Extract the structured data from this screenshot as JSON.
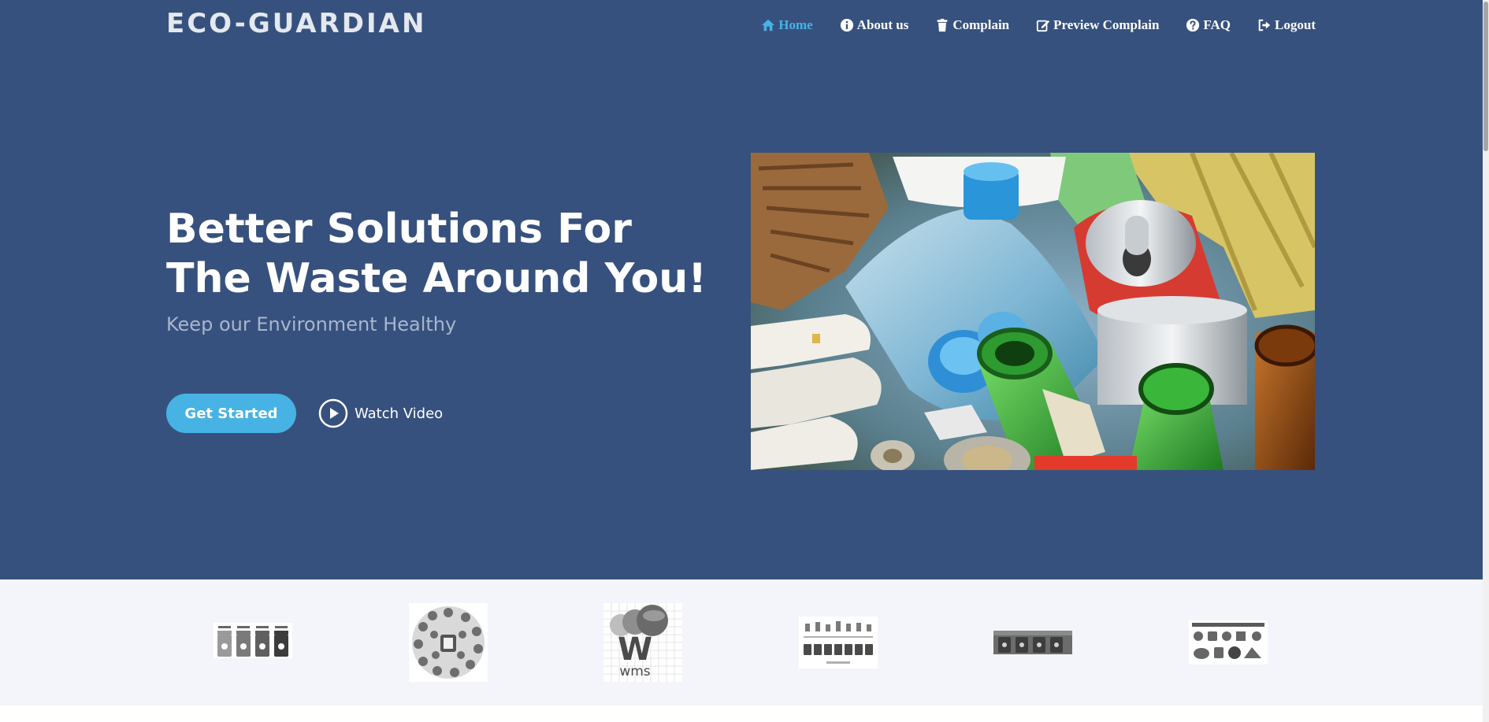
{
  "brand": {
    "logo": "ECO-GUARDIAN"
  },
  "nav": {
    "items": [
      {
        "label": "Home",
        "icon": "home-icon",
        "active": true
      },
      {
        "label": "About us",
        "icon": "info-circle-icon",
        "active": false
      },
      {
        "label": "Complain",
        "icon": "trash-icon",
        "active": false
      },
      {
        "label": "Preview Complain",
        "icon": "edit-icon",
        "active": false
      },
      {
        "label": "FAQ",
        "icon": "question-circle-icon",
        "active": false
      },
      {
        "label": "Logout",
        "icon": "logout-icon",
        "active": false
      }
    ]
  },
  "hero": {
    "title": "Better Solutions For The Waste Around You!",
    "subtitle": "Keep our Environment Healthy",
    "cta_label": "Get Started",
    "video_label": "Watch Video",
    "image_icon": "recyclable-waste-photo"
  },
  "clients": {
    "logos": [
      {
        "icon": "recycling-bins-logo"
      },
      {
        "icon": "eco-circle-icons-logo"
      },
      {
        "icon": "wms-logo",
        "text": "wms",
        "letter": "W"
      },
      {
        "icon": "waste-sorting-chart-logo"
      },
      {
        "icon": "garbage-bins-banner-logo"
      },
      {
        "icon": "waste-types-chart-logo"
      }
    ]
  },
  "colors": {
    "hero_bg": "#37517e",
    "accent": "#47b2e4",
    "clients_bg": "#f3f5fa",
    "nav_text": "#ffffff"
  }
}
